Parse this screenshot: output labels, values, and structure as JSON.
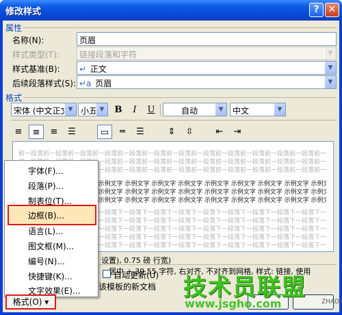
{
  "window": {
    "title": "修改样式",
    "help_glyph": "?",
    "close_glyph": "✕"
  },
  "properties": {
    "section_label": "属性",
    "name_label": "名称(N):",
    "name_value": "页眉",
    "style_type_label": "样式类型(T):",
    "style_type_value": "链接段落和字符",
    "based_on_label": "样式基准(B):",
    "based_on_value": "正文",
    "based_on_icon": "↵",
    "next_style_label": "后续段落样式(S):",
    "next_style_value": "页眉",
    "next_style_icon": "↵a"
  },
  "format": {
    "section_label": "格式",
    "font": "宋体 (中文正文",
    "size": "小五",
    "bold": "B",
    "italic": "I",
    "underline": "U",
    "color": "自动",
    "language": "中文"
  },
  "preview": {
    "before_text": "前一段落前一段落前一段落前一段落前一段落前一段落前一段落前一段落前一段落前一段落前一段落前一段落前一段落前一段落前一段落",
    "sample_text": "示例文字 示例文字 示例文字 示例文字 示例文字 示例文字 示例文字 示例文字 示例文字 示例文字 示例文字 示例文字 示例文字 示例文字",
    "after_text": "下一段落下一段落下一段落下一段落下一段落下一段落下一段落下一段落下一段落下一段落下一段落下一段落下一段落下一段落下一段落"
  },
  "description": {
    "line1": "设置), 0.75 磅 行宽)",
    "line2": "，居中 + 39.55 字符, 右对齐, 不对齐到网格, 样式: 链接, 使用"
  },
  "options": {
    "auto_update_label": "自动更新(U)",
    "template_label": "该模板的新文档"
  },
  "menu": {
    "items": [
      "字体(F)...",
      "段落(P)...",
      "制表位(T)...",
      "边框(B)...",
      "语言(L)...",
      "图文框(M)...",
      "编号(N)...",
      "快捷键(K)...",
      "文字效果(E)..."
    ],
    "highlighted_index": 3
  },
  "format_button": {
    "label": "格式(O) ▾"
  },
  "watermark": {
    "main": "技术员联盟",
    "url": "www.jsgho.com",
    "small": "ZHAOW"
  }
}
